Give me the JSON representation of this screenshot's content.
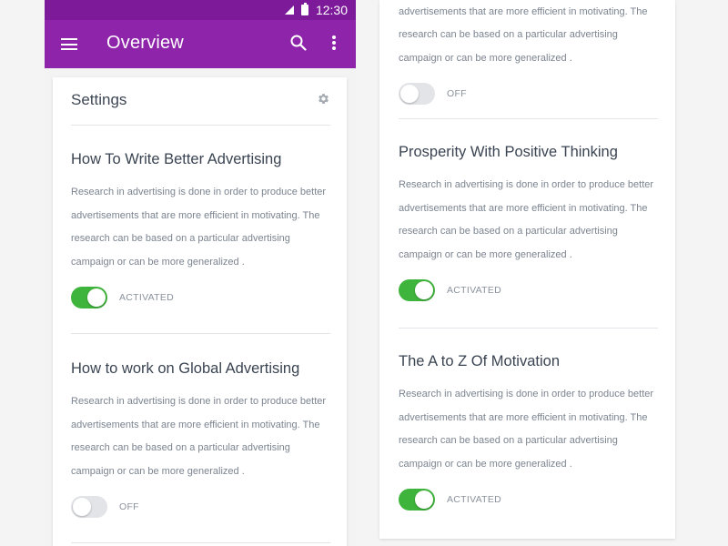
{
  "status_bar": {
    "time": "12:30"
  },
  "app_bar": {
    "title": "Overview"
  },
  "settings": {
    "title": "Settings"
  },
  "left_items": [
    {
      "title": "How To Write Better Advertising",
      "description": "Research in advertising is done in order to produce better advertisements that are more efficient in motivating. The research can be based on a particular advertising campaign or can be more generalized .",
      "toggle_on": true,
      "toggle_label": "ACTIVATED"
    },
    {
      "title": "How to work on Global Advertising",
      "description": "Research in advertising is done in order to produce better advertisements that are more efficient in motivating. The research can be based on a particular advertising campaign or can be more generalized .",
      "toggle_on": false,
      "toggle_label": "OFF"
    }
  ],
  "right_top": {
    "description": "Research in advertising is done in order to produce better advertisements that are more efficient in motivating. The research can be based on a particular advertising campaign or can be more generalized .",
    "toggle_on": false,
    "toggle_label": "OFF"
  },
  "right_items": [
    {
      "title": "Prosperity With Positive Thinking",
      "description": "Research in advertising is done in order to produce better advertisements that are more efficient in motivating. The research can be based on a particular advertising campaign or can be more generalized .",
      "toggle_on": true,
      "toggle_label": "ACTIVATED"
    },
    {
      "title": "The A to Z Of Motivation",
      "description": "Research in advertising is done in order to produce better advertisements that are more efficient in motivating. The research can be based on a particular advertising campaign or can be more generalized .",
      "toggle_on": true,
      "toggle_label": "ACTIVATED"
    }
  ],
  "colors": {
    "status_bar": "#7c1a99",
    "app_bar": "#8e24aa",
    "toggle_on": "#3fb43c",
    "toggle_off": "#e2e4e8"
  },
  "icons": [
    "signal-icon",
    "battery-icon",
    "menu-icon",
    "search-icon",
    "more-vert-icon",
    "gear-icon"
  ]
}
